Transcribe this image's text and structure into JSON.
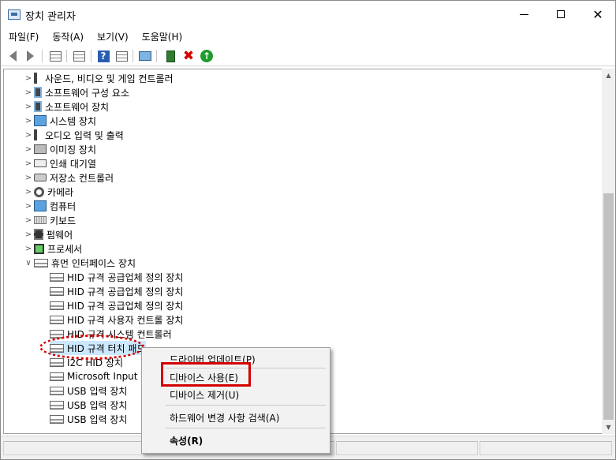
{
  "window": {
    "title": "장치 관리자"
  },
  "menubar": {
    "items": [
      "파일(F)",
      "동작(A)",
      "보기(V)",
      "도움말(H)"
    ]
  },
  "toolbar": {
    "icons": [
      "back-icon",
      "forward-icon",
      "properties-icon",
      "show-hidden-icon",
      "help-icon",
      "view-icon",
      "scan-monitor-icon",
      "update-driver-icon",
      "uninstall-icon",
      "enable-icon"
    ]
  },
  "tree": {
    "categories": [
      {
        "label": "사운드, 비디오 및 게임 컨트롤러"
      },
      {
        "label": "소프트웨어 구성 요소"
      },
      {
        "label": "소프트웨어 장치"
      },
      {
        "label": "시스템 장치"
      },
      {
        "label": "오디오 입력 및 출력"
      },
      {
        "label": "이미징 장치"
      },
      {
        "label": "인쇄 대기열"
      },
      {
        "label": "저장소 컨트롤러"
      },
      {
        "label": "카메라"
      },
      {
        "label": "컴퓨터"
      },
      {
        "label": "키보드"
      },
      {
        "label": "펌웨어"
      },
      {
        "label": "프로세서"
      },
      {
        "label": "휴먼 인터페이스 장치"
      }
    ],
    "hid_children": [
      {
        "label": "HID 규격 공급업체 정의 장치"
      },
      {
        "label": "HID 규격 공급업체 정의 장치"
      },
      {
        "label": "HID 규격 공급업체 정의 장치"
      },
      {
        "label": "HID 규격 사용자 컨트롤 장치"
      },
      {
        "label": "HID 규격 시스템 컨트롤러"
      },
      {
        "label": "HID 규격 터치 패드"
      },
      {
        "label": "I2C HID 장치"
      },
      {
        "label": "Microsoft Input C"
      },
      {
        "label": "USB 입력 장치"
      },
      {
        "label": "USB 입력 장치"
      },
      {
        "label": "USB 입력 장치"
      }
    ]
  },
  "context_menu": {
    "update_driver": "드라이버 업데이트(P)",
    "enable_device": "디바이스 사용(E)",
    "uninstall_device": "디바이스 제거(U)",
    "scan_hardware": "하드웨어 변경 사항 검색(A)",
    "properties": "속성(R)"
  },
  "colors": {
    "highlight": "#d40000",
    "selection": "#cce8ff"
  }
}
